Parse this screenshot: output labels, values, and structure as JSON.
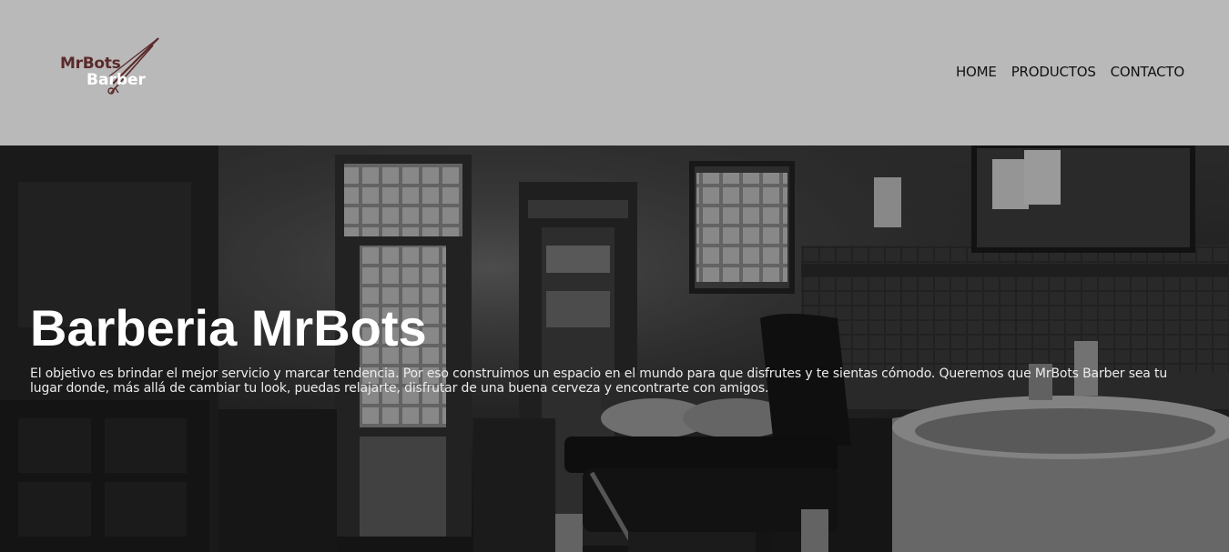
{
  "header": {
    "logo": {
      "line1": "MrBots",
      "line2": "Barber",
      "icon": "scissors-icon"
    },
    "nav": [
      {
        "label": "HOME"
      },
      {
        "label": "PRODUCTOS"
      },
      {
        "label": "CONTACTO"
      }
    ]
  },
  "hero": {
    "title": "Barberia MrBots",
    "description": "El objetivo es brindar el mejor servicio y marcar tendencia. Por eso construimos un espacio en el mundo para que disfrutes y te sientas cómodo. Queremos que MrBots Barber sea tu lugar donde, más allá de cambiar tu look, puedas relajarte, disfrutar de una buena cerveza y encontrarte con amigos.",
    "background": "barbershop-interior-photo"
  },
  "colors": {
    "header_bg": "#b9b9b9",
    "logo_accent": "#5a2a2a",
    "nav_text": "#111111",
    "hero_text": "#ffffff"
  }
}
